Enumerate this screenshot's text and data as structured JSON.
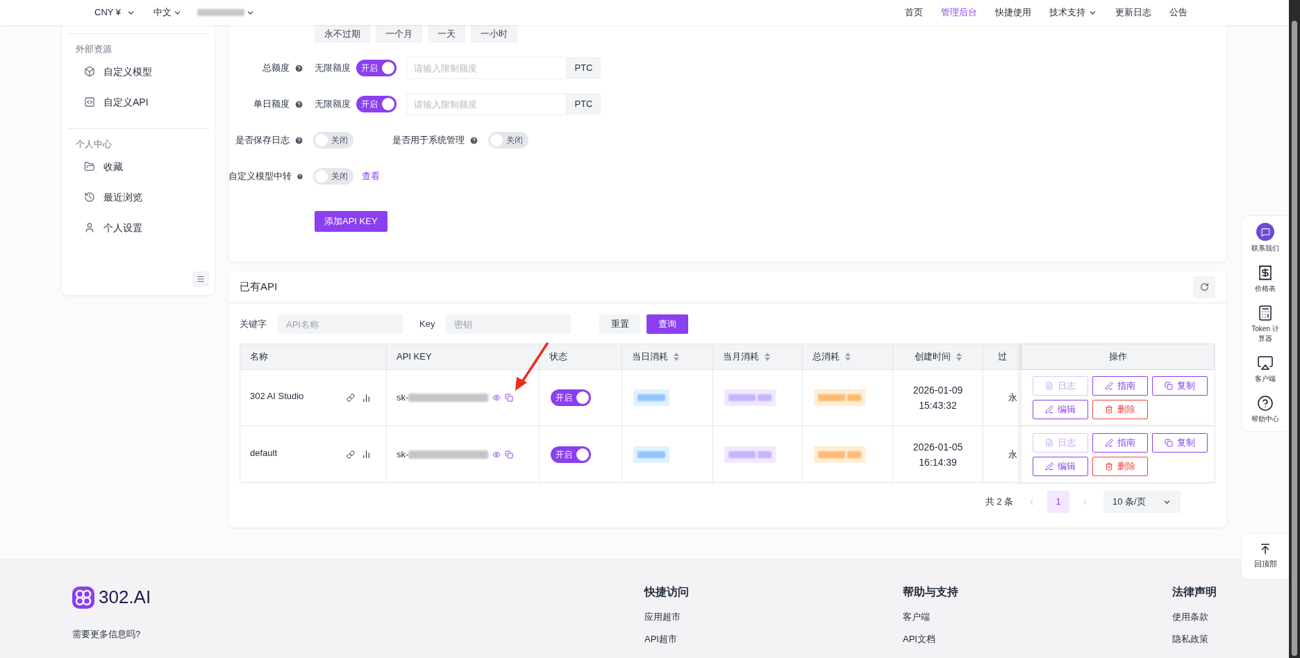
{
  "topbar": {
    "currency": "CNY ¥",
    "language": "中文",
    "nav": [
      {
        "label": "首页",
        "selected": false,
        "dropdown": false
      },
      {
        "label": "管理后台",
        "selected": true,
        "dropdown": false
      },
      {
        "label": "快捷使用",
        "selected": false,
        "dropdown": false
      },
      {
        "label": "技术支持",
        "selected": false,
        "dropdown": true
      },
      {
        "label": "更新日志",
        "selected": false,
        "dropdown": false
      },
      {
        "label": "公告",
        "selected": false,
        "dropdown": false
      }
    ]
  },
  "sidebar": {
    "sections": [
      {
        "title": "外部资源",
        "items": [
          {
            "label": "自定义模型"
          },
          {
            "label": "自定义API"
          }
        ]
      },
      {
        "title": "个人中心",
        "items": [
          {
            "label": "收藏"
          },
          {
            "label": "最近浏览"
          },
          {
            "label": "个人设置"
          }
        ]
      }
    ]
  },
  "form": {
    "expiry_options": [
      "永不过期",
      "一个月",
      "一天",
      "一小时"
    ],
    "quota_rows": [
      {
        "label": "总额度",
        "unlimited_label": "无限额度",
        "on": true,
        "toggle_text": "开启",
        "placeholder": "请输入限制额度",
        "unit": "PTC"
      },
      {
        "label": "单日额度",
        "unlimited_label": "无限额度",
        "on": true,
        "toggle_text": "开启",
        "placeholder": "请输入限制额度",
        "unit": "PTC"
      }
    ],
    "switch_rows": [
      [
        {
          "label": "是否保存日志",
          "on": false,
          "toggle_text": "关闭"
        },
        {
          "label": "是否用于系统管理",
          "on": false,
          "toggle_text": "关闭"
        }
      ],
      [
        {
          "label": "自定义模型中转",
          "on": false,
          "toggle_text": "关闭",
          "link": "查看"
        }
      ]
    ],
    "submit": "添加API KEY"
  },
  "api_list": {
    "title": "已有API",
    "filters": [
      {
        "label": "关键字",
        "placeholder": "API名称"
      },
      {
        "label": "Key",
        "placeholder": "密钥"
      }
    ],
    "reset": "重置",
    "query": "查询",
    "columns": [
      {
        "label": "名称",
        "sortable": false
      },
      {
        "label": "API KEY",
        "sortable": false
      },
      {
        "label": "状态",
        "sortable": false
      },
      {
        "label": "当日消耗",
        "sortable": true
      },
      {
        "label": "当月消耗",
        "sortable": true
      },
      {
        "label": "总消耗",
        "sortable": true
      },
      {
        "label": "创建时间",
        "sortable": true
      },
      {
        "label": "过",
        "sortable": false
      },
      {
        "label": "操作",
        "sortable": false
      }
    ],
    "rows": [
      {
        "name": "302 AI Studio",
        "key_prefix": "sk-",
        "on": true,
        "status_text": "开启",
        "created_date": "2026-01-09",
        "created_time": "15:43:32",
        "expiry": "永",
        "actions": [
          {
            "label": "日志",
            "kind": "log",
            "disabled": true
          },
          {
            "label": "指南",
            "kind": "guide",
            "disabled": false
          },
          {
            "label": "复制",
            "kind": "copy",
            "disabled": false
          },
          {
            "label": "编辑",
            "kind": "edit",
            "disabled": false
          },
          {
            "label": "删除",
            "kind": "delete",
            "disabled": false
          }
        ]
      },
      {
        "name": "default",
        "key_prefix": "sk-",
        "on": true,
        "status_text": "开启",
        "created_date": "2026-01-05",
        "created_time": "16:14:39",
        "expiry": "永",
        "actions": [
          {
            "label": "日志",
            "kind": "log",
            "disabled": true
          },
          {
            "label": "指南",
            "kind": "guide",
            "disabled": false
          },
          {
            "label": "复制",
            "kind": "copy",
            "disabled": false
          },
          {
            "label": "编辑",
            "kind": "edit",
            "disabled": false
          },
          {
            "label": "删除",
            "kind": "delete",
            "disabled": false
          }
        ]
      }
    ],
    "pagination": {
      "total": "共 2 条",
      "pages": [
        {
          "label": "1",
          "selected": true
        }
      ],
      "page_size": "10 条/页"
    }
  },
  "floating_tools": [
    {
      "label": "联系我们"
    },
    {
      "label": "价格表"
    },
    {
      "label": "Token 计算器"
    },
    {
      "label": "客户端"
    },
    {
      "label": "帮助中心"
    }
  ],
  "back_to_top": "回顶部",
  "footer": {
    "brand": "302.AI",
    "tagline": "需要更多信息吗?",
    "columns": [
      {
        "title": "快捷访问",
        "links": [
          "应用超市",
          "API超市"
        ]
      },
      {
        "title": "帮助与支持",
        "links": [
          "客户端",
          "API文档"
        ]
      },
      {
        "title": "法律声明",
        "links": [
          "使用条款",
          "隐私政策"
        ]
      }
    ]
  }
}
